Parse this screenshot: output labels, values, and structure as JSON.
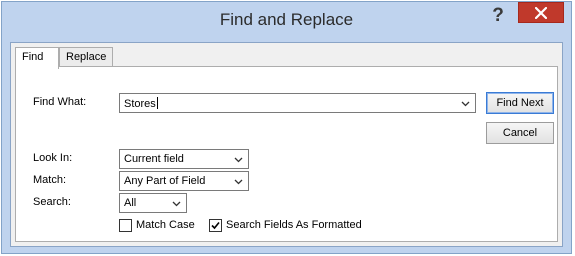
{
  "window": {
    "title": "Find and Replace",
    "help_label": "?",
    "close_label": "Close"
  },
  "tabs": [
    {
      "label": "Find",
      "active": true
    },
    {
      "label": "Replace",
      "active": false
    }
  ],
  "find_what": {
    "label": "Find What:",
    "value": "Stores"
  },
  "look_in": {
    "label": "Look In:",
    "value": "Current field"
  },
  "match": {
    "label": "Match:",
    "value": "Any Part of Field"
  },
  "search": {
    "label": "Search:",
    "value": "All"
  },
  "buttons": {
    "find_next": "Find Next",
    "cancel": "Cancel"
  },
  "options": {
    "match_case": {
      "label": "Match Case",
      "checked": false
    },
    "search_formatted": {
      "label": "Search Fields As Formatted",
      "checked": true
    }
  },
  "colors": {
    "title_bg": "#bfd3ee",
    "close_bg": "#c0392b",
    "panel_bg": "#ffffff"
  }
}
